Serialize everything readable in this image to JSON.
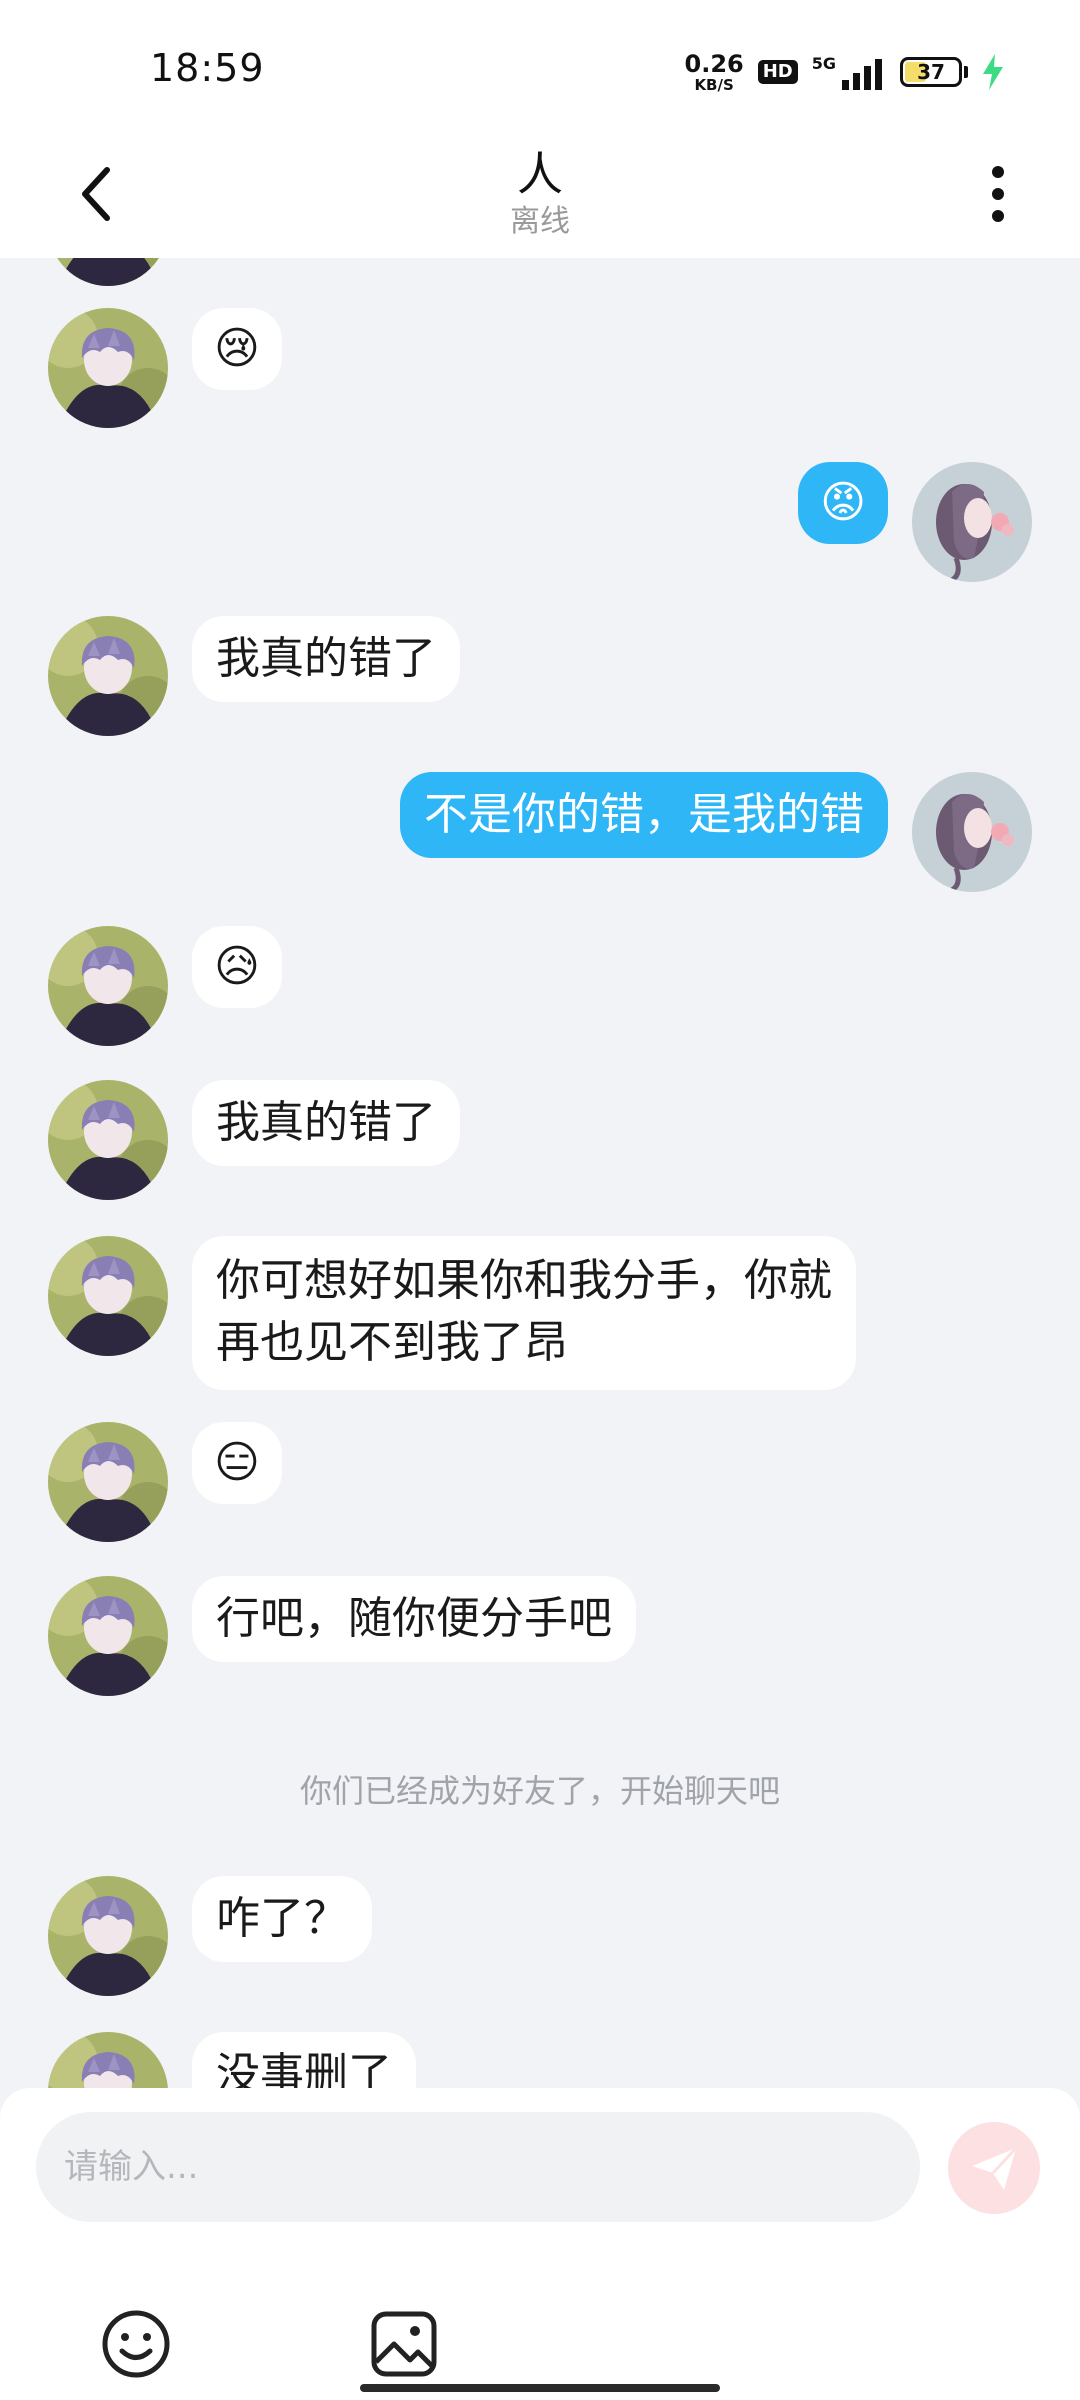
{
  "status_bar": {
    "time": "18:59",
    "net_speed_value": "0.26",
    "net_speed_unit": "KB/S",
    "hd_label": "HD",
    "signal_label": "5G",
    "battery_level": "37",
    "battery_fill_color": "#f4dd6a",
    "charging_color": "#3ddc84"
  },
  "header": {
    "title": "人",
    "subtitle": "离线",
    "back_icon": "chevron-left-icon",
    "more_icon": "more-vertical-icon"
  },
  "messages": [
    {
      "side": "left",
      "type": "emoji",
      "text": "😢"
    },
    {
      "side": "right",
      "type": "emoji",
      "text": "😡"
    },
    {
      "side": "left",
      "type": "text",
      "text": "我真的错了"
    },
    {
      "side": "right",
      "type": "text",
      "text": "不是你的错，是我的错"
    },
    {
      "side": "left",
      "type": "emoji",
      "text": "😥"
    },
    {
      "side": "left",
      "type": "text",
      "text": "我真的错了"
    },
    {
      "side": "left",
      "type": "text",
      "text": "你可想好如果你和我分手，你就\n再也见不到我了昂"
    },
    {
      "side": "left",
      "type": "emoji",
      "text": "😑"
    },
    {
      "side": "left",
      "type": "text",
      "text": "行吧，随你便分手吧"
    },
    {
      "side": "left",
      "type": "text",
      "text": "咋了？"
    },
    {
      "side": "left",
      "type": "text",
      "text": "没事删了"
    }
  ],
  "system_note": "你们已经成为好友了，开始聊天吧",
  "composer": {
    "placeholder": "请输入...",
    "send_icon": "send-icon",
    "emoji_icon": "emoji-icon",
    "image_icon": "image-icon"
  },
  "colors": {
    "outgoing_bubble": "#2eb6f7",
    "incoming_bubble": "#ffffff",
    "chat_background": "#f1f3f6",
    "send_button_bg": "#fde0e2"
  }
}
